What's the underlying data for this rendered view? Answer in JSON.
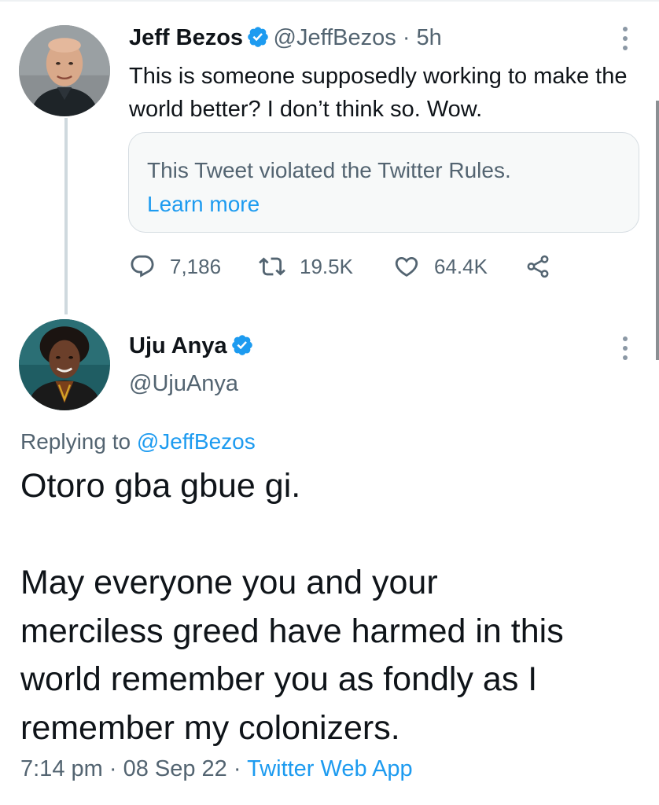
{
  "colors": {
    "accent": "#1d9bf0",
    "text": "#0f1419",
    "muted": "#536471",
    "border": "#d6dde2",
    "card_bg": "#f7f9f9"
  },
  "parent_tweet": {
    "name": "Jeff Bezos",
    "handle": "@JeffBezos",
    "separator": " · ",
    "time": "5h",
    "verified_icon": "verified-badge-icon",
    "text": "This is someone supposedly working to make the world better? I don’t think so. Wow.",
    "notice": {
      "text": "This Tweet violated the Twitter Rules.",
      "link": "Learn more"
    },
    "stats": {
      "replies": "7,186",
      "retweets": "19.5K",
      "likes": "64.4K"
    },
    "icons": [
      "reply-icon",
      "retweet-icon",
      "like-icon",
      "share-icon",
      "more-icon"
    ]
  },
  "reply_tweet": {
    "name": "Uju Anya",
    "handle": "@UjuAnya",
    "verified_icon": "verified-badge-icon",
    "replying_prefix": "Replying to ",
    "replying_to": "@JeffBezos",
    "body_line_1": "Otoro gba gbue gi.",
    "body_line_2": "May everyone you and your",
    "body_line_3": "merciless greed have harmed in this",
    "body_line_4": "world remember you as fondly as I",
    "body_line_5": "remember my colonizers.",
    "time": "7:14 pm",
    "date": "08 Sep 22",
    "dot": " · ",
    "source": "Twitter Web App"
  }
}
